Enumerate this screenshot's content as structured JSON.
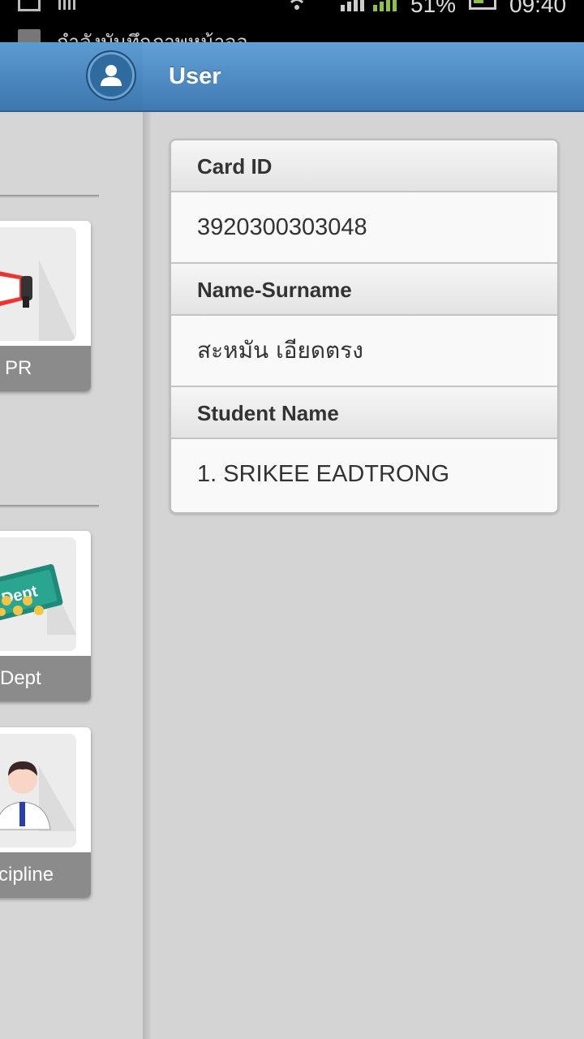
{
  "status_bar": {
    "notification_text": "กำลังบันทึกภาพหน้าจอ",
    "battery_percent": "51%",
    "time": "09:40"
  },
  "drawer": {
    "menu_items": [
      {
        "label": "PR",
        "icon": "megaphone-icon"
      },
      {
        "label": "Dept",
        "icon": "money-dept-icon"
      },
      {
        "label": "scipline",
        "icon": "student-icon"
      }
    ]
  },
  "header": {
    "title": "User",
    "avatar_icon": "user-avatar-icon"
  },
  "user_info": {
    "card_id_label": "Card ID",
    "card_id_value": "3920300303048",
    "name_label": "Name-Surname",
    "name_value": "สะหมัน เอียดตรง",
    "student_label": "Student Name",
    "student_value": "1. SRIKEE EADTRONG"
  },
  "colors": {
    "header_blue": "#4f8cc4",
    "tile_label_bg": "#8b8b8b",
    "background": "#d4d4d4"
  }
}
